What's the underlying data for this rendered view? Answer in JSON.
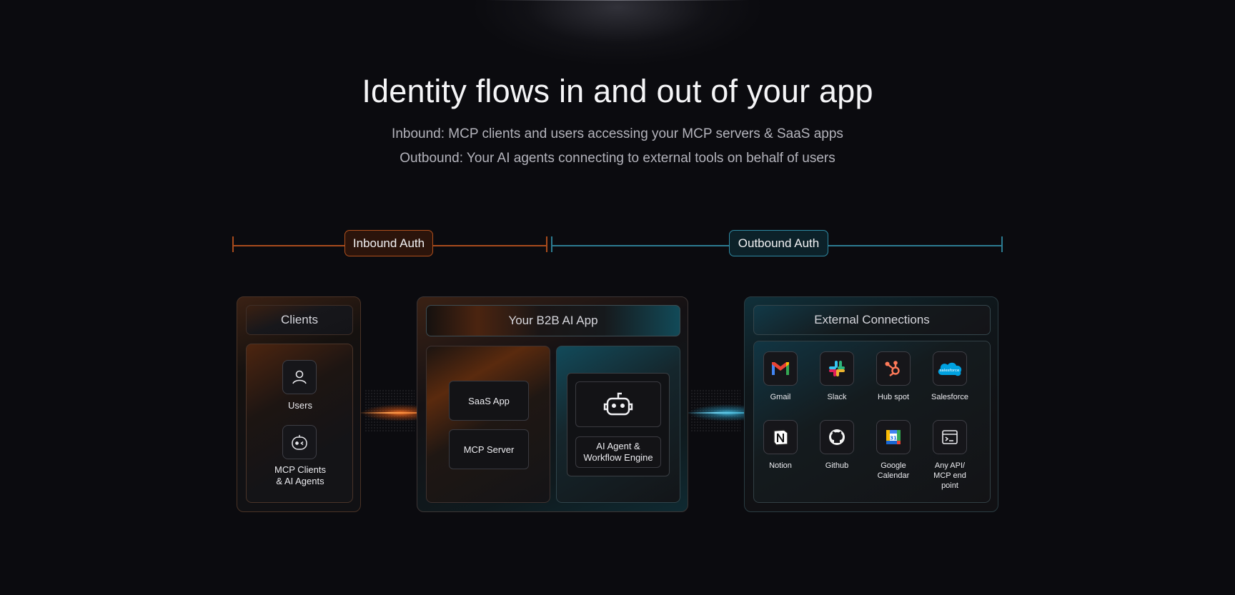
{
  "header": {
    "title": "Identity flows in and out of your app",
    "subtitle_inbound": "Inbound: MCP clients and users accessing your MCP servers & SaaS apps",
    "subtitle_outbound": "Outbound: Your AI agents connecting to external tools on behalf of users"
  },
  "auth": {
    "inbound_label": "Inbound Auth",
    "outbound_label": "Outbound Auth",
    "inbound_color": "#a84b1c",
    "outbound_color": "#2c7b91"
  },
  "clients": {
    "title": "Clients",
    "users_label": "Users",
    "mcp_line1": "MCP Clients",
    "mcp_line2": "& AI Agents"
  },
  "app": {
    "title": "Your B2B AI App",
    "saas_label": "SaaS App",
    "mcp_server_label": "MCP Server",
    "agent_line1": "AI Agent &",
    "agent_line2": "Workflow Engine"
  },
  "external": {
    "title": "External Connections",
    "items": [
      {
        "label": "Gmail",
        "icon": "gmail-icon"
      },
      {
        "label": "Slack",
        "icon": "slack-icon"
      },
      {
        "label": "Hub spot",
        "icon": "hubspot-icon"
      },
      {
        "label": "Salesforce",
        "icon": "salesforce-icon",
        "icon_text": "salesforce"
      },
      {
        "label": "Notion",
        "icon": "notion-icon"
      },
      {
        "label": "Github",
        "icon": "github-icon"
      },
      {
        "label": "Google\nCalendar",
        "icon": "google-calendar-icon",
        "icon_text": "31"
      },
      {
        "label": "Any API/\nMCP end\npoint",
        "icon": "terminal-icon"
      }
    ]
  }
}
